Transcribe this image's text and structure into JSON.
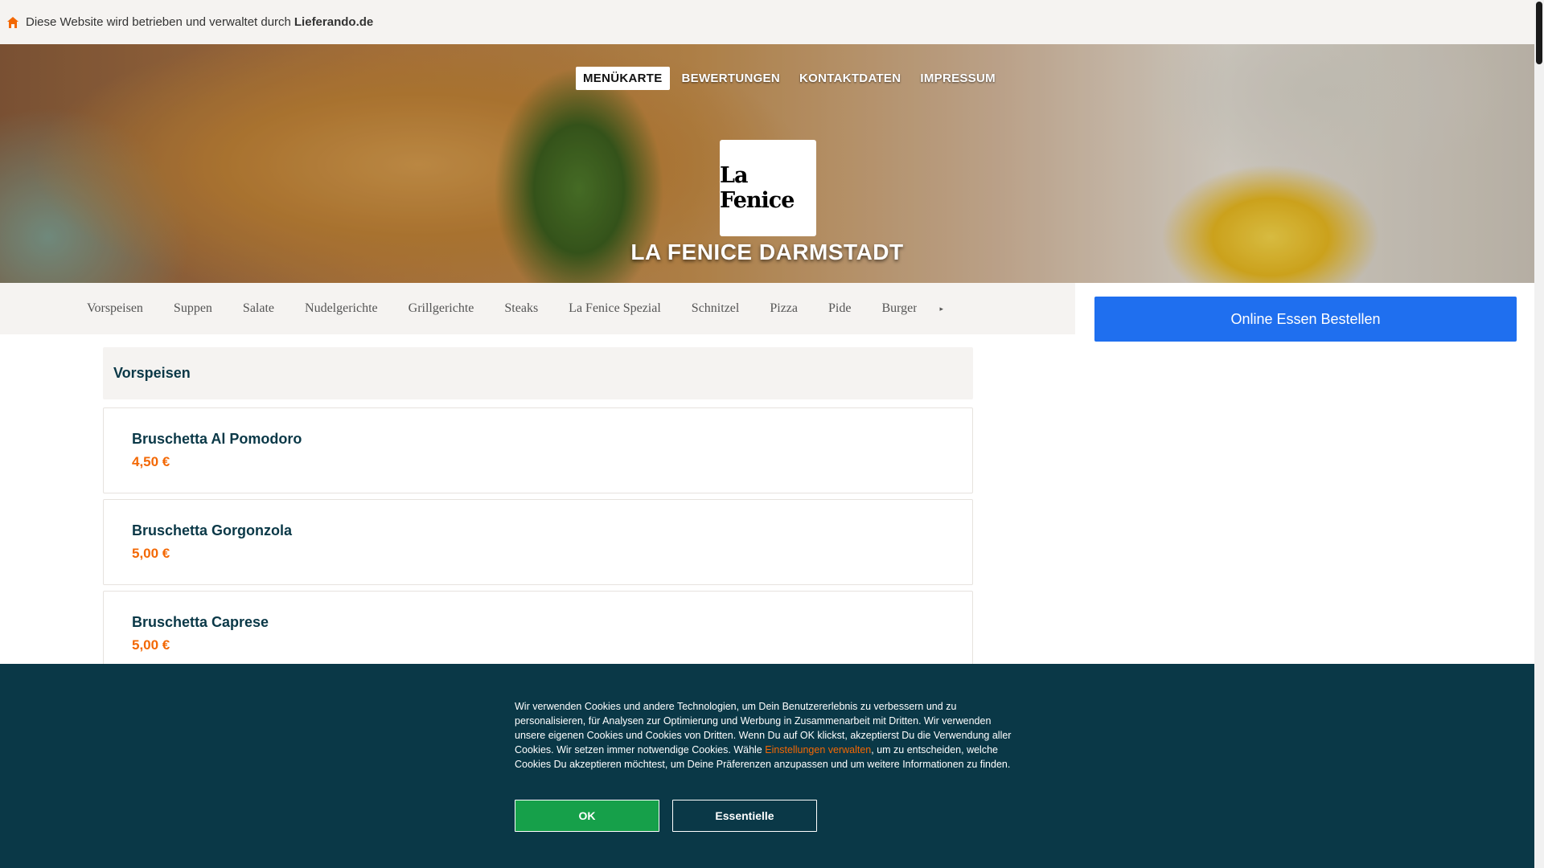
{
  "topbar": {
    "text": "Diese Website wird betrieben und verwaltet durch",
    "brand": "Lieferando.de",
    "icon": "home-icon"
  },
  "nav": {
    "items": [
      "MENÜKARTE",
      "BEWERTUNGEN",
      "KONTAKTDATEN",
      "IMPRESSUM"
    ],
    "active": "MENÜKARTE"
  },
  "restaurant": {
    "logo_text": "La Fenice",
    "title": "LA FENICE DARMSTADT"
  },
  "categories": [
    "Vorspeisen",
    "Suppen",
    "Salate",
    "Nudelgerichte",
    "Grillgerichte",
    "Steaks",
    "La Fenice Spezial",
    "Schnitzel",
    "Pizza",
    "Pide",
    "Burger"
  ],
  "order_button": "Online Essen Bestellen",
  "menu": {
    "section_title": "Vorspeisen",
    "items": [
      {
        "name": "Bruschetta Al Pomodoro",
        "price": "4,50 €"
      },
      {
        "name": "Bruschetta Gorgonzola",
        "price": "5,00 €"
      },
      {
        "name": "Bruschetta Caprese",
        "price": "5,00 €"
      }
    ]
  },
  "cookie": {
    "text_before": "Wir verwenden Cookies und andere Technologien, um Dein Benutzererlebnis zu verbessern und zu personalisieren, für Analysen zur Optimierung und Werbung in Zusammenarbeit mit Dritten. Wir verwenden unsere eigenen Cookies und Cookies von Dritten. Wenn Du auf OK klickst, akzeptierst Du die Verwendung aller Cookies. Wir setzen immer notwendige Cookies. Wähle ",
    "link": "Einstellungen verwalten",
    "text_after": ", um zu entscheiden, welche Cookies Du akzeptieren möchtest, um Deine Präferenzen anzupassen und um weitere Informationen zu finden.",
    "ok_label": "OK",
    "essential_label": "Essentielle"
  },
  "colors": {
    "accent_orange": "#f36805",
    "order_blue": "#1f6fef",
    "cookie_bg": "#0a3847",
    "ok_green": "#16a04a"
  }
}
